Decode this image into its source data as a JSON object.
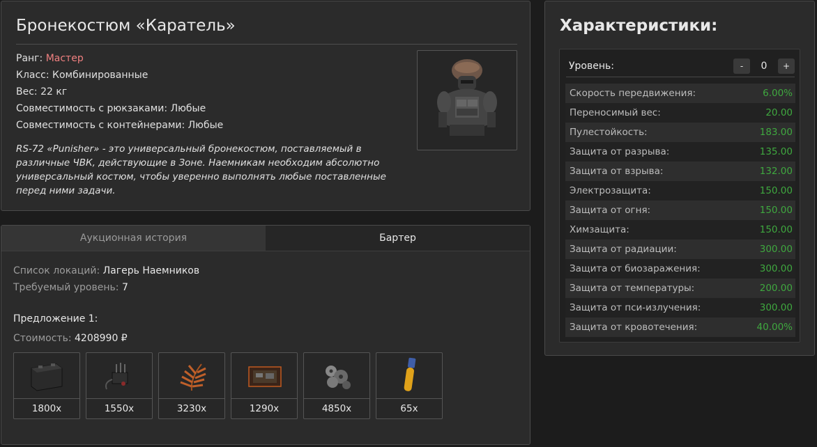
{
  "item": {
    "title": "Бронекостюм «Каратель»",
    "rank_label": "Ранг:",
    "rank_value": "Мастер",
    "class_label": "Класс:",
    "class_value": "Комбинированные",
    "weight_label": "Вес:",
    "weight_value": "22 кг",
    "backpack_label": "Совместимость с рюкзаками:",
    "backpack_value": "Любые",
    "container_label": "Совместимость с контейнерами:",
    "container_value": "Любые",
    "description": "RS-72 «Punisher» - это универсальный бронекостюм, поставляемый в различные ЧВК, действующие в Зоне. Наемникам необходим абсолютно универсальный костюм, чтобы уверенно выполнять любые поставленные перед ними задачи.",
    "image_icon": "armor-suit-icon"
  },
  "tabs": [
    {
      "label": "Аукционная история",
      "active": false
    },
    {
      "label": "Бартер",
      "active": true
    }
  ],
  "barter": {
    "locations_label": "Список локаций:",
    "locations_value": "Лагерь Наемников",
    "level_label": "Требуемый уровень:",
    "level_value": "7",
    "offer_title": "Предложение 1:",
    "cost_label": "Стоимость:",
    "cost_value": "4208990 ₽",
    "items": [
      {
        "qty": "1800x",
        "icon": "battery-icon"
      },
      {
        "qty": "1550x",
        "icon": "device-icon"
      },
      {
        "qty": "3230x",
        "icon": "fern-plant-icon"
      },
      {
        "qty": "1290x",
        "icon": "circuit-board-icon"
      },
      {
        "qty": "4850x",
        "icon": "scrap-parts-icon"
      },
      {
        "qty": "65x",
        "icon": "vial-icon"
      }
    ]
  },
  "stats": {
    "title": "Характеристики:",
    "level_label": "Уровень:",
    "level_minus": "-",
    "level_value": "0",
    "level_plus": "+",
    "rows": [
      {
        "name": "Скорость передвижения:",
        "value": "6.00%"
      },
      {
        "name": "Переносимый вес:",
        "value": "20.00"
      },
      {
        "name": "Пулестойкость:",
        "value": "183.00"
      },
      {
        "name": "Защита от разрыва:",
        "value": "135.00"
      },
      {
        "name": "Защита от взрыва:",
        "value": "132.00"
      },
      {
        "name": "Электрозащита:",
        "value": "150.00"
      },
      {
        "name": "Защита от огня:",
        "value": "150.00"
      },
      {
        "name": "Химзащита:",
        "value": "150.00"
      },
      {
        "name": "Защита от радиации:",
        "value": "300.00"
      },
      {
        "name": "Защита от биозаражения:",
        "value": "300.00"
      },
      {
        "name": "Защита от температуры:",
        "value": "200.00"
      },
      {
        "name": "Защита от пси-излучения:",
        "value": "300.00"
      },
      {
        "name": "Защита от кровотечения:",
        "value": "40.00%"
      }
    ]
  }
}
